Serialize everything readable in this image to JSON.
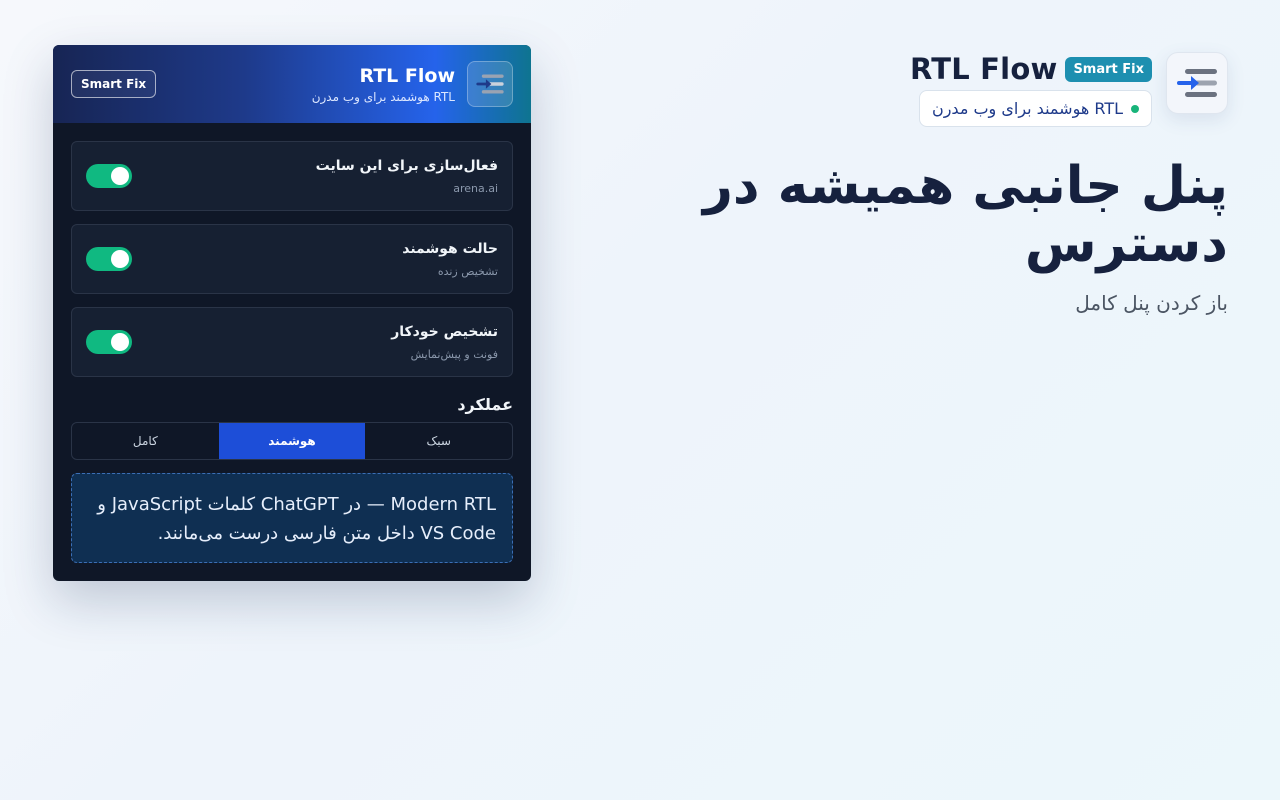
{
  "colors": {
    "accent": "#1d4ed8",
    "toggle_on": "#10b981",
    "badge_bg": "#1d8fb0",
    "panel_bg": "#0f1727",
    "heading": "#16213e"
  },
  "hero": {
    "brand_title": "RTL Flow",
    "badge": "Smart Fix",
    "subtitle": "RTL هوشمند برای وب مدرن",
    "heading": "پنل جانبی همیشه در دسترس",
    "subheading": "باز کردن پنل کامل",
    "logo_icon": "rtl-flow-logo-icon"
  },
  "panel": {
    "header": {
      "title": "RTL Flow",
      "subtitle": "RTL هوشمند برای وب مدرن",
      "badge": "Smart Fix",
      "logo_icon": "rtl-flow-logo-icon"
    },
    "settings": [
      {
        "title": "فعال‌سازی برای این سایت",
        "desc": "arena.ai",
        "enabled": true
      },
      {
        "title": "حالت هوشمند",
        "desc": "تشخیص زنده",
        "enabled": true
      },
      {
        "title": "تشخیص خودکار",
        "desc": "فونت و پیش‌نمایش",
        "enabled": true
      }
    ],
    "mode_section_title": "عملکرد",
    "modes": [
      {
        "label": "سبک",
        "active": false
      },
      {
        "label": "هوشمند",
        "active": true
      },
      {
        "label": "کامل",
        "active": false
      }
    ],
    "notice": "Modern RTL — در ChatGPT کلمات JavaScript و VS Code داخل متن فارسی درست می‌مانند."
  }
}
